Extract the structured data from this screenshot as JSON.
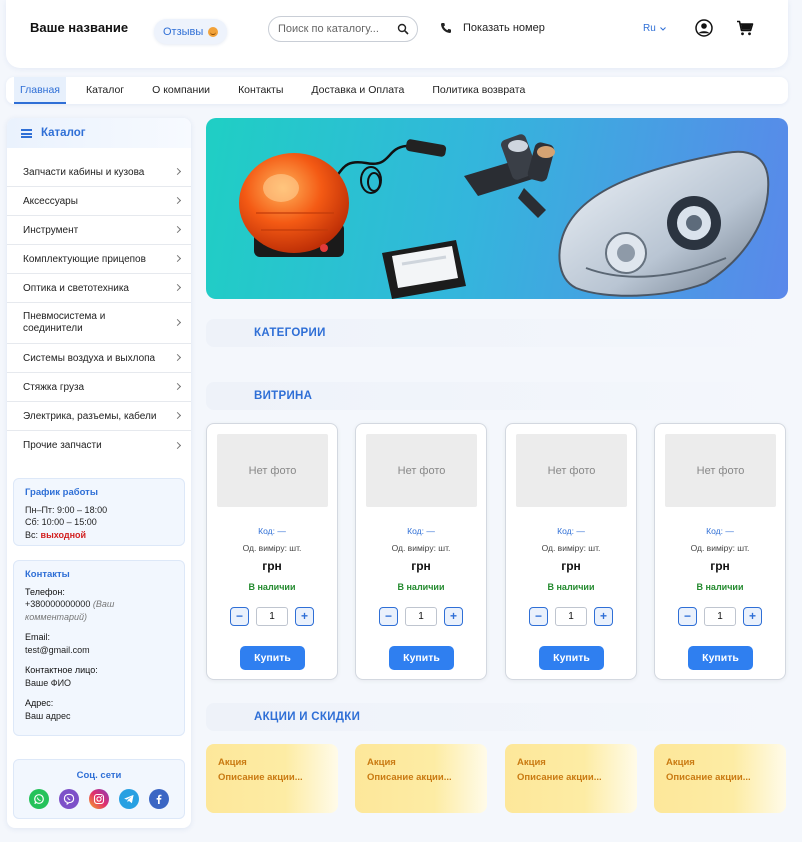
{
  "header": {
    "brand": "Ваше название",
    "reviews_label": "Отзывы",
    "search_placeholder": "Поиск по каталогу...",
    "phone_label": "Показать номер",
    "language": "Ru"
  },
  "nav": {
    "items": [
      "Главная",
      "Каталог",
      "О компании",
      "Контакты",
      "Доставка и Оплата",
      "Политика возврата"
    ]
  },
  "sidebar": {
    "title": "Каталог",
    "categories": [
      "Запчасти кабины и кузова",
      "Аксессуары",
      "Инструмент",
      "Комплектующие прицепов",
      "Оптика и светотехника",
      "Пневмосистема и соединители",
      "Системы воздуха и выхлопа",
      "Стяжка груза",
      "Электрика, разъемы, кабели",
      "Прочие запчасти"
    ],
    "schedule": {
      "title": "График работы",
      "weekdays": "Пн–Пт: 9:00 – 18:00",
      "saturday": "Сб: 10:00 – 15:00",
      "sunday_label": "Вс:",
      "sunday_value": "выходной"
    },
    "contacts": {
      "title": "Контакты",
      "phone_label": "Телефон:",
      "phone_value": "+380000000000",
      "phone_comment": "(Ваш комментарий)",
      "email_label": "Email:",
      "email_value": "test@gmail.com",
      "person_label": "Контактное лицо:",
      "person_value": "Ваше ФИО",
      "address_label": "Адрес:",
      "address_value": "Ваш адрес"
    },
    "social": {
      "title": "Соц. сети",
      "icons": [
        "whatsapp-icon",
        "viber-icon",
        "instagram-icon",
        "telegram-icon",
        "facebook-icon"
      ]
    }
  },
  "sections": {
    "categories": "КАТЕГОРИИ",
    "showcase": "ВИТРИНА",
    "promos": "АКЦИИ И СКИДКИ"
  },
  "products": [
    {
      "photo": "Нет фото",
      "code": "Код: —",
      "unit": "Од. виміру: шт.",
      "price": "грн",
      "stock": "В наличии",
      "qty": "1",
      "buy": "Купить"
    },
    {
      "photo": "Нет фото",
      "code": "Код: —",
      "unit": "Од. виміру: шт.",
      "price": "грн",
      "stock": "В наличии",
      "qty": "1",
      "buy": "Купить"
    },
    {
      "photo": "Нет фото",
      "code": "Код: —",
      "unit": "Од. виміру: шт.",
      "price": "грн",
      "stock": "В наличии",
      "qty": "1",
      "buy": "Купить"
    },
    {
      "photo": "Нет фото",
      "code": "Код: —",
      "unit": "Од. виміру: шт.",
      "price": "грн",
      "stock": "В наличии",
      "qty": "1",
      "buy": "Купить"
    }
  ],
  "qty_minus": "−",
  "qty_plus": "+",
  "promos": [
    {
      "title": "Акция",
      "desc": "Описание акции..."
    },
    {
      "title": "Акция",
      "desc": "Описание акции..."
    },
    {
      "title": "Акция",
      "desc": "Описание акции..."
    },
    {
      "title": "Акция",
      "desc": "Описание акции..."
    }
  ],
  "colors": {
    "accent": "#2f6fd6",
    "buy_button": "#2f7ff0",
    "in_stock": "#238a2e",
    "day_off": "#d21f1f",
    "promo_text": "#c97a12"
  }
}
